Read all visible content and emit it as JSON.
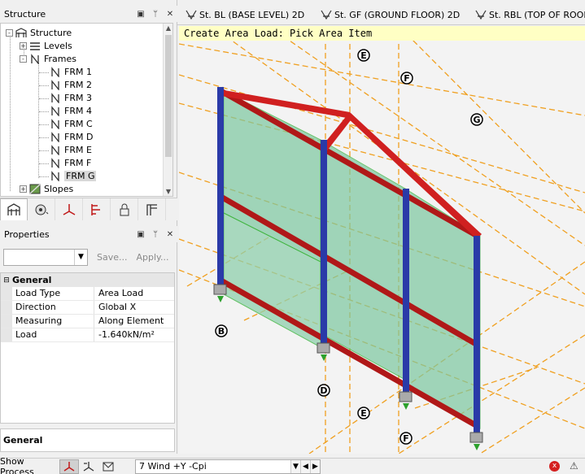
{
  "structure_panel": {
    "title": "Structure",
    "tree": [
      {
        "label": "Structure",
        "expander": "-"
      },
      {
        "label": "Levels",
        "expander": "+"
      },
      {
        "label": "Frames",
        "expander": "-"
      },
      {
        "label": "FRM 1"
      },
      {
        "label": "FRM 2"
      },
      {
        "label": "FRM 3"
      },
      {
        "label": "FRM 4"
      },
      {
        "label": "FRM C"
      },
      {
        "label": "FRM D"
      },
      {
        "label": "FRM E"
      },
      {
        "label": "FRM F"
      },
      {
        "label": "FRM G"
      },
      {
        "label": "Slopes",
        "expander": "+"
      }
    ],
    "selected": "FRM G",
    "tool_tabs": [
      "structure-tab",
      "loading-tab",
      "analysis-tab",
      "design-tab",
      "lock-tab",
      "drawing-tab"
    ]
  },
  "properties_panel": {
    "title": "Properties",
    "save_label": "Save...",
    "apply_label": "Apply...",
    "category": "General",
    "rows": [
      {
        "key": "Load Type",
        "value": "Area Load"
      },
      {
        "key": "Direction",
        "value": "Global X"
      },
      {
        "key": "Measuring",
        "value": "Along Element"
      },
      {
        "key": "Load",
        "value": "-1.640kN/m²"
      }
    ],
    "description": "General"
  },
  "view_tabs": [
    {
      "label": "St. BL (BASE LEVEL) 2D"
    },
    {
      "label": "St. GF (GROUND FLOOR) 2D"
    },
    {
      "label": "St. RBL (TOP OF ROOF B"
    }
  ],
  "prompt": "Create Area Load: Pick Area Item",
  "grid_labels": [
    "E",
    "F",
    "G",
    "B",
    "D",
    "E",
    "F"
  ],
  "status_bar": {
    "show_process": "Show Process",
    "load_case": "7 Wind +Y -Cpi",
    "error_count": "x"
  },
  "colors": {
    "column": "#2a3aa8",
    "beam": "#c01818",
    "panel": "#7cc8a0",
    "gridline": "#f0a020",
    "prompt_bg": "#ffffc4"
  }
}
